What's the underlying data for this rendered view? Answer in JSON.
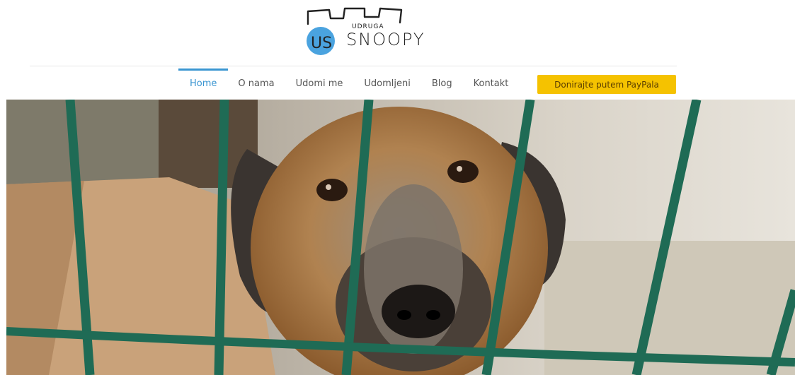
{
  "brand": {
    "small": "UDRUGA",
    "big": "SNOOPY"
  },
  "nav": {
    "items": [
      {
        "label": "Home",
        "active": true
      },
      {
        "label": "O nama",
        "active": false
      },
      {
        "label": "Udomi me",
        "active": false
      },
      {
        "label": "Udomljeni",
        "active": false
      },
      {
        "label": "Blog",
        "active": false
      },
      {
        "label": "Kontakt",
        "active": false
      }
    ],
    "donate_label": "Donirajte putem PayPala"
  },
  "colors": {
    "accent": "#3a95d1",
    "donate_bg": "#f5c200",
    "fence": "#1f6b55"
  },
  "hero": {
    "icon": "dog-behind-fence-photo"
  }
}
